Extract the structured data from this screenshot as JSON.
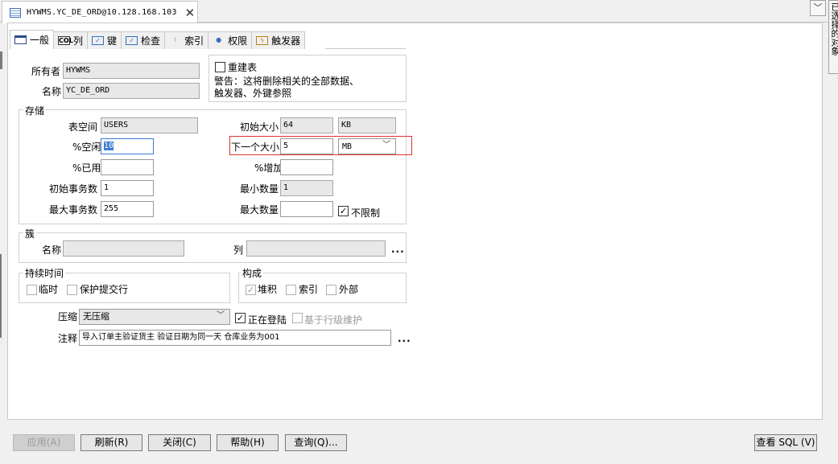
{
  "document_tab": {
    "title": "HYWMS.YC_DE_ORD@10.128.168.103",
    "close_glyph": "✕"
  },
  "side_panel": {
    "label": "已选择的对象"
  },
  "subtabs": [
    {
      "label": "一般",
      "icon": "general-icon"
    },
    {
      "label": "列",
      "icon": "column-icon"
    },
    {
      "label": "键",
      "icon": "key-icon"
    },
    {
      "label": "检查",
      "icon": "check-icon"
    },
    {
      "label": "索引",
      "icon": "index-icon"
    },
    {
      "label": "权限",
      "icon": "privilege-icon"
    },
    {
      "label": "触发器",
      "icon": "trigger-icon"
    }
  ],
  "general": {
    "owner_label": "所有者",
    "owner_value": "HYWMS",
    "name_label": "名称",
    "name_value": "YC_DE_ORD",
    "rebuild_label": "重建表",
    "warning_line1": "警告：这将删除相关的全部数据、",
    "warning_line2": "触发器、外键参照"
  },
  "storage": {
    "title": "存储",
    "tablespace_label": "表空间",
    "tablespace_value": "USERS",
    "pctfree_label": "%空闲",
    "pctfree_value": "10",
    "pctused_label": "%已用",
    "pctused_value": "",
    "initrans_label": "初始事务数",
    "initrans_value": "1",
    "maxtrans_label": "最大事务数",
    "maxtrans_value": "255",
    "initial_label": "初始大小",
    "initial_value": "64",
    "initial_unit": "KB",
    "next_label": "下一个大小",
    "next_value": "5",
    "next_unit": "MB",
    "pctincrease_label": "%增加",
    "pctincrease_value": "",
    "minextents_label": "最小数量",
    "minextents_value": "1",
    "maxextents_label": "最大数量",
    "maxextents_value": "",
    "unlimited_label": "不限制"
  },
  "cluster": {
    "title": "簇",
    "name_label": "名称",
    "name_value": "",
    "column_label": "列",
    "column_value": "",
    "more": "..."
  },
  "duration": {
    "title": "持续时间",
    "temp_label": "临时",
    "preserve_label": "保护提交行"
  },
  "organization": {
    "title": "构成",
    "heap_label": "堆积",
    "index_label": "索引",
    "external_label": "外部"
  },
  "compress": {
    "label": "压缩",
    "value": "无压缩",
    "logging_label": "正在登陆",
    "row_level_label": "基于行级维护"
  },
  "comment": {
    "label": "注释",
    "value": "导入订单主验证货主  验证日期为同一天 仓库业务为001",
    "more": "..."
  },
  "buttons": {
    "apply": "应用(A)",
    "refresh": "刷新(R)",
    "close": "关闭(C)",
    "help": "帮助(H)",
    "query": "查询(Q)...",
    "view_sql": "查看 SQL (V)"
  },
  "dropdown_glyph": "﹀",
  "highlight_color": "#dd3333"
}
